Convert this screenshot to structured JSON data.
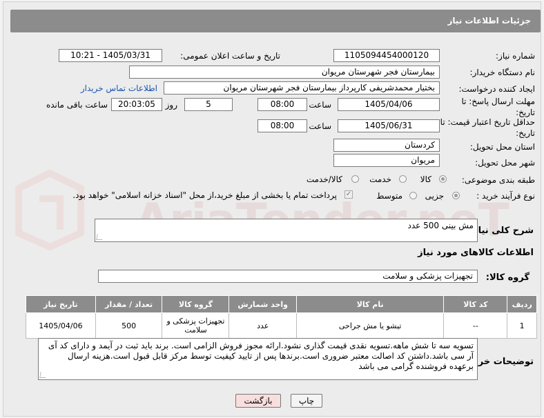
{
  "header": {
    "title": "جزئیات اطلاعات نیاز"
  },
  "need_number": {
    "label": "شماره نیاز:",
    "value": "1105094454000120"
  },
  "announce": {
    "label": "تاریخ و ساعت اعلان عمومی:",
    "value": "1405/03/31 - 10:21"
  },
  "buyer_org": {
    "label": "نام دستگاه خریدار:",
    "value": "بیمارستان فجر شهرستان مریوان"
  },
  "creator": {
    "label": "ایجاد کننده درخواست:",
    "value": "بختیار محمدشریفی کارپرداز بیمارستان فجر شهرستان مریوان",
    "contact_link": "اطلاعات تماس خریدار"
  },
  "reply_deadline": {
    "label": "مهلت ارسال پاسخ: تا تاریخ:",
    "date": "1405/04/06",
    "time_label": "ساعت",
    "time": "08:00",
    "days": "5",
    "days_label": "روز و",
    "remaining": "20:03:05",
    "remaining_label": "ساعت باقی مانده"
  },
  "price_validity": {
    "label": "حداقل تاریخ اعتبار قیمت: تا تاریخ:",
    "date": "1405/06/31",
    "time_label": "ساعت",
    "time": "08:00"
  },
  "province": {
    "label": "استان محل تحویل:",
    "value": "کردستان"
  },
  "city": {
    "label": "شهر محل تحویل:",
    "value": "مریوان"
  },
  "category": {
    "label": "طبقه بندی موضوعی:",
    "options": [
      "کالا",
      "خدمت",
      "کالا/خدمت"
    ],
    "selected": 0
  },
  "purchase_type": {
    "label": "نوع فرآیند خرید :",
    "options": [
      "جزیی",
      "متوسط"
    ],
    "selected": 0,
    "payment_note": "پرداخت تمام یا بخشی از مبلغ خرید،از محل \"اسناد خزانه اسلامی\" خواهد بود."
  },
  "description": {
    "label": "شرح کلی نیاز:",
    "value": "مش بینی 500 عدد"
  },
  "goods_info": {
    "title": "اطلاعات کالاهای مورد نیاز"
  },
  "goods_group": {
    "label": "گروه کالا:",
    "value": "تجهیزات پزشکی و سلامت"
  },
  "table": {
    "headers": [
      "ردیف",
      "کد کالا",
      "نام کالا",
      "واحد شمارش",
      "گروه کالا",
      "تعداد / مقدار",
      "تاریخ نیاز"
    ],
    "rows": [
      [
        "1",
        "--",
        "تیشو یا مش جراحی",
        "عدد",
        "تجهیزات پزشکی و سلامت",
        "500",
        "1405/04/06"
      ]
    ]
  },
  "buyer_notes": {
    "label": "توضیحات خریدار:",
    "value": "تسویه سه تا شش ماهه.تسویه نقدی قیمت گذاری نشود.ارائه مجوز فروش الزامی است. برند باید ثبت در آیمد و دارای کد آی آر سی باشد.داشتن کد اصالت معتبر ضروری است.برندها پس از تایید کیفیت توسط مرکز قابل قبول است.هزینه ارسال برعهده فروشنده گرامی می باشد"
  },
  "buttons": {
    "print": "چاپ",
    "back": "بازگشت"
  },
  "watermark": {
    "text": "AriaTender.neT"
  },
  "colors": {
    "header_bg": "#8c8c8c",
    "link": "#1a55b0",
    "back_button": "#f9dede"
  }
}
